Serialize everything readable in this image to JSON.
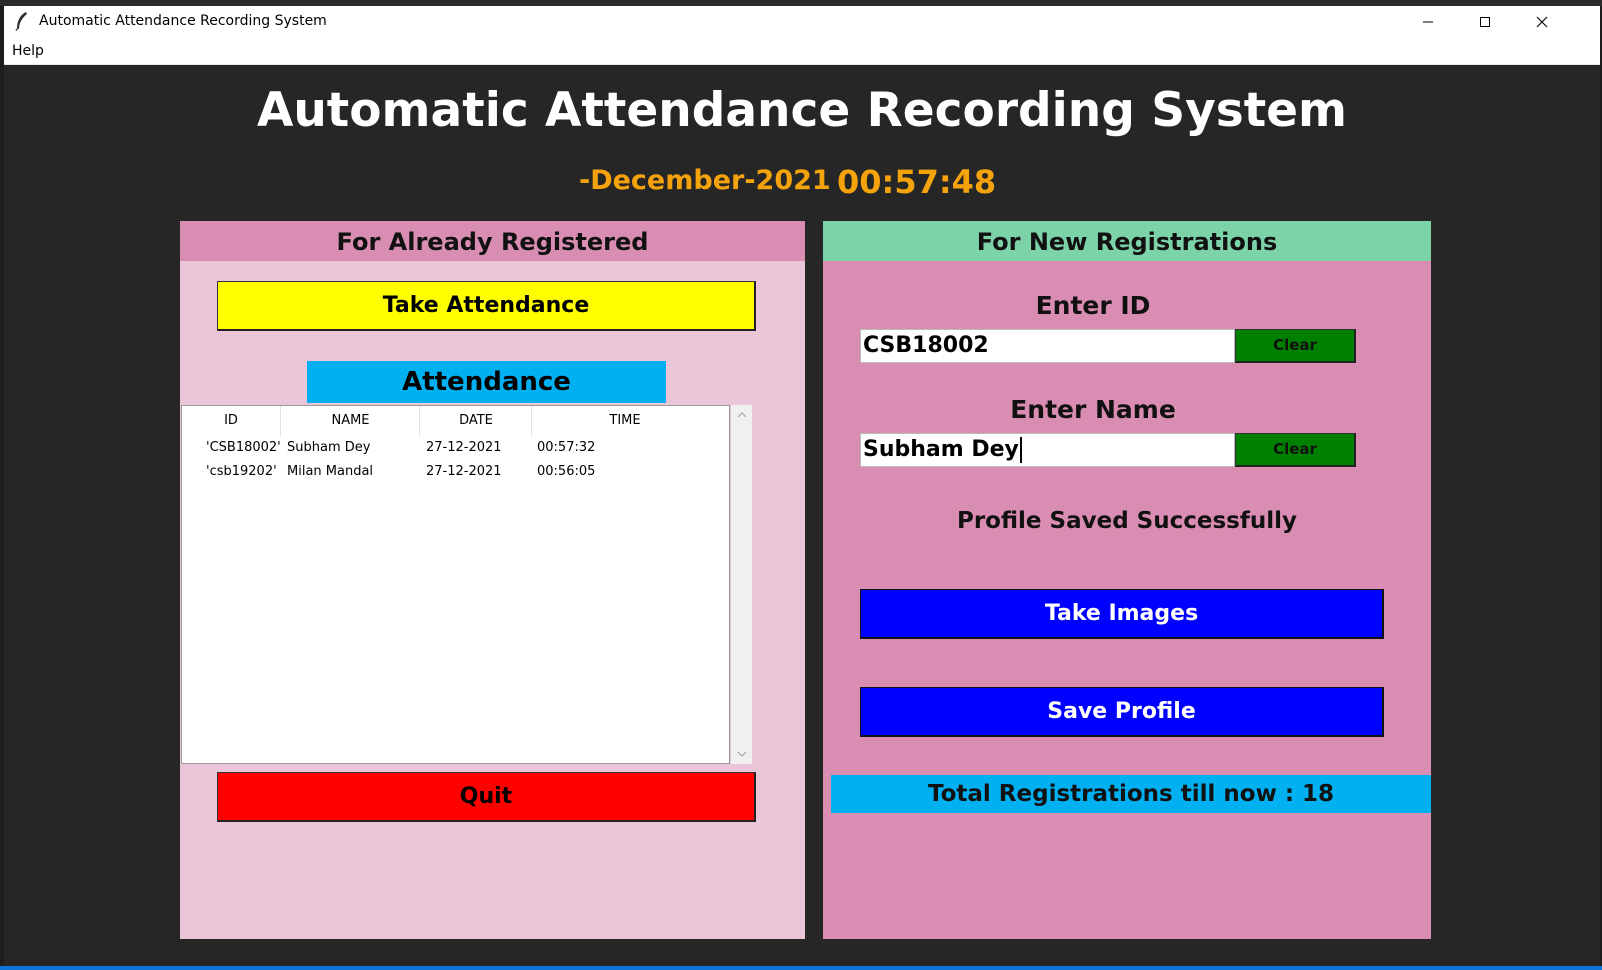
{
  "window": {
    "title": "Automatic Attendance Recording System"
  },
  "menu": {
    "help": "Help"
  },
  "app": {
    "title": "Automatic Attendance Recording System",
    "date": "-December-2021",
    "clock": "00:57:48"
  },
  "left_panel": {
    "header": "For Already Registered",
    "take_attendance_button": "Take Attendance",
    "attendance_label": "Attendance",
    "columns": [
      "ID",
      "NAME",
      "DATE",
      "TIME"
    ],
    "rows": [
      {
        "id": "'CSB18002'",
        "name": "Subham Dey",
        "date": "27-12-2021",
        "time": "00:57:32"
      },
      {
        "id": "'csb19202'",
        "name": "Milan Mandal",
        "date": "27-12-2021",
        "time": "00:56:05"
      }
    ],
    "quit_button": "Quit"
  },
  "right_panel": {
    "header": "For New Registrations",
    "enter_id_label": "Enter ID",
    "id_value": "CSB18002",
    "clear_label": "Clear",
    "enter_name_label": "Enter Name",
    "name_value": "Subham Dey",
    "status_message": "Profile Saved Successfully",
    "take_images_button": "Take Images",
    "save_profile_button": "Save Profile",
    "total_registrations": "Total Registrations till now  : 18"
  },
  "colors": {
    "background": "#262626",
    "accent_orange": "#f5a30c",
    "left_header": "#d98db2",
    "left_body": "#ebc6d9",
    "right_header": "#7dd3a8",
    "right_body": "#d98db2",
    "attendance_label": "#00b0f0",
    "take_attendance": "#ffff00",
    "quit": "#ff0000",
    "clear": "#008000",
    "blue_button": "#0000ff"
  }
}
